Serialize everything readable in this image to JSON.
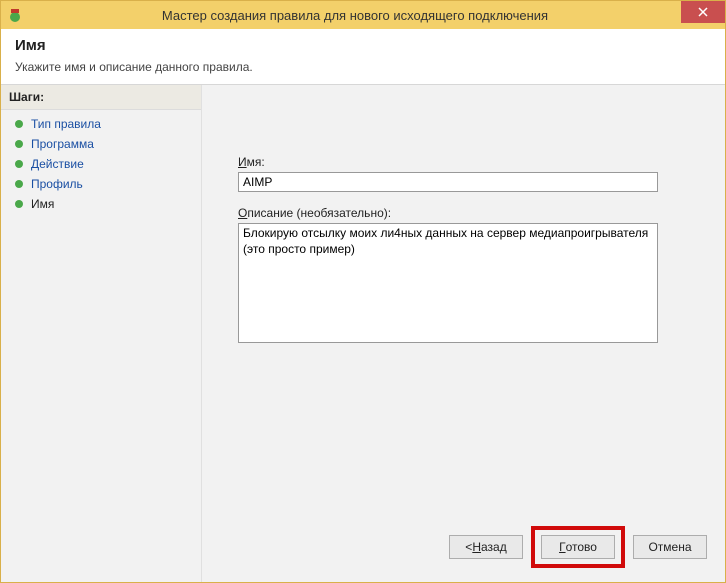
{
  "titlebar": {
    "title": "Мастер создания правила для нового исходящего подключения"
  },
  "header": {
    "heading": "Имя",
    "subtitle": "Укажите имя и описание данного правила."
  },
  "sidebar": {
    "steps_label": "Шаги:",
    "items": [
      {
        "label": "Тип правила"
      },
      {
        "label": "Программа"
      },
      {
        "label": "Действие"
      },
      {
        "label": "Профиль"
      },
      {
        "label": "Имя"
      }
    ]
  },
  "form": {
    "name_label_u": "И",
    "name_label_rest": "мя:",
    "name_value": "AIMP",
    "desc_label_u": "О",
    "desc_label_rest": "писание (необязательно):",
    "desc_value": "Блокирую отсылку моих ли4ных данных на сервер медиапроигрывателя (это просто пример)"
  },
  "buttons": {
    "back_prefix": "< ",
    "back_u": "Н",
    "back_rest": "азад",
    "finish_u": "Г",
    "finish_rest": "отово",
    "cancel": "Отмена"
  }
}
